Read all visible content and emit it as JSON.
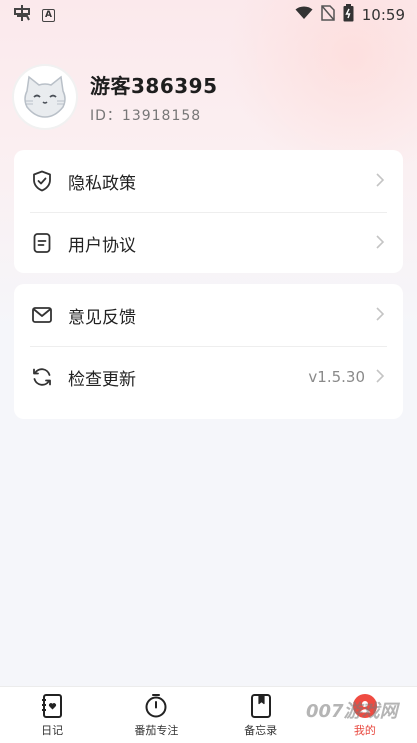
{
  "statusbar": {
    "time": "10:59"
  },
  "profile": {
    "name": "游客386395",
    "id_label": "ID：13918158"
  },
  "menu_group_1": [
    {
      "label": "隐私政策",
      "icon": "shield-check-icon"
    },
    {
      "label": "用户协议",
      "icon": "document-icon"
    }
  ],
  "menu_group_2": [
    {
      "label": "意见反馈",
      "icon": "mail-icon"
    },
    {
      "label": "检查更新",
      "icon": "refresh-icon",
      "value": "v1.5.30"
    }
  ],
  "tabs": [
    {
      "label": "日记",
      "icon": "diary-icon"
    },
    {
      "label": "番茄专注",
      "icon": "timer-icon"
    },
    {
      "label": "备忘录",
      "icon": "memo-icon"
    },
    {
      "label": "我的",
      "icon": "profile-icon",
      "active": true
    }
  ],
  "colors": {
    "accent": "#ef4b41",
    "background": "#f5f6fa",
    "card": "#ffffff"
  },
  "watermark": "007游戏网"
}
